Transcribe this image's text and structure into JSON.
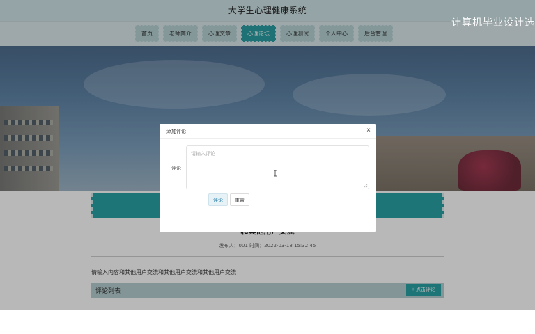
{
  "header": {
    "title": "大学生心理健康系统"
  },
  "watermark": "计算机毕业设计选",
  "nav": {
    "items": [
      {
        "label": "首页",
        "active": false
      },
      {
        "label": "老师简介",
        "active": false
      },
      {
        "label": "心理文章",
        "active": false
      },
      {
        "label": "心理论坛",
        "active": true
      },
      {
        "label": "心理测试",
        "active": false
      },
      {
        "label": "个人中心",
        "active": false
      },
      {
        "label": "后台管理",
        "active": false
      }
    ]
  },
  "post": {
    "title": "和其他用户交流",
    "meta": "发布人：001 时间：2022-03-18 15:32:45",
    "body": "请输入内容和其他用户交流和其他用户交流和其他用户交流"
  },
  "comments": {
    "list_label": "评论列表",
    "add_button": "+ 点击评论"
  },
  "modal": {
    "title": "添加评论",
    "close": "×",
    "field_label": "评论",
    "placeholder": "请输入评论",
    "submit_label": "评论",
    "reset_label": "重置"
  },
  "colors": {
    "accent": "#2aa3a6",
    "nav_bg": "#dbe9ec",
    "header_bg": "#cfe3e6"
  }
}
